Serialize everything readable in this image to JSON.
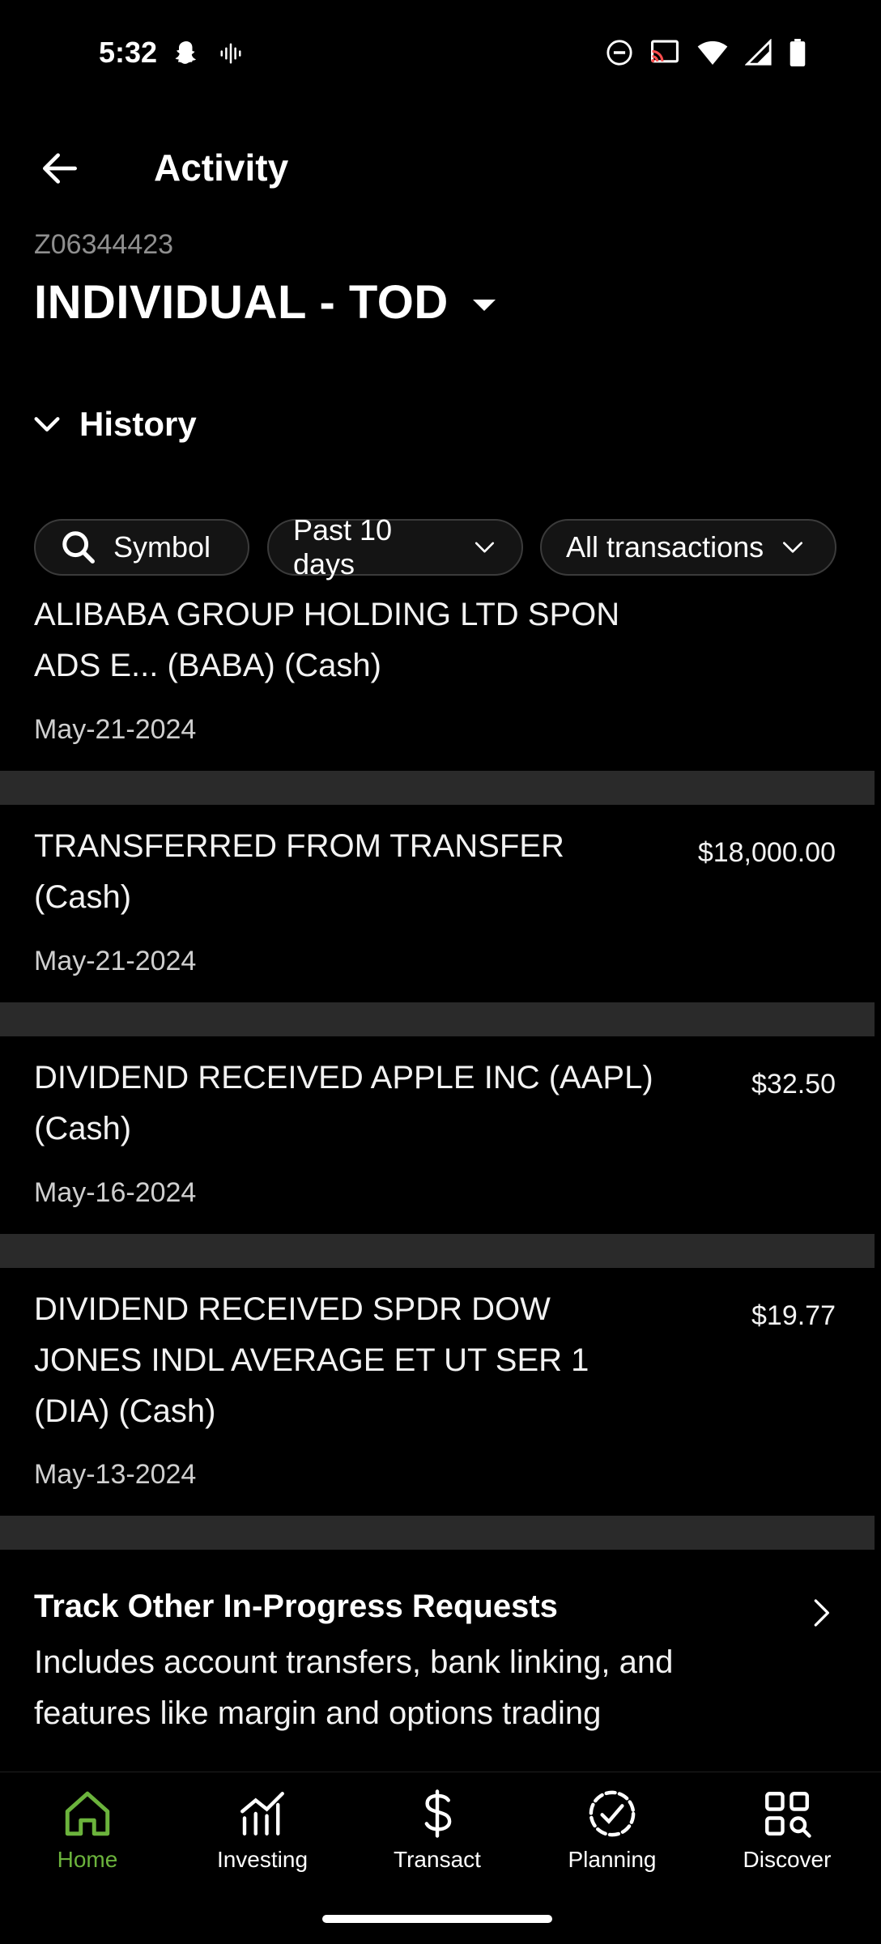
{
  "status_bar": {
    "time": "5:32",
    "icons_left": [
      "snapchat-icon",
      "voice-icon"
    ],
    "icons_right": [
      "dnd-icon",
      "cast-icon",
      "wifi-icon",
      "signal-icon",
      "battery-icon"
    ]
  },
  "header": {
    "title": "Activity",
    "account_number": "Z06344423",
    "account_name": "INDIVIDUAL - TOD"
  },
  "history": {
    "label": "History"
  },
  "filters": {
    "symbol": "Symbol",
    "period": "Past 10 days",
    "type": "All transactions"
  },
  "transactions": [
    {
      "desc_line1": "ALIBABA GROUP HOLDING LTD SPON",
      "desc_line2": "ADS E... (BABA) (Cash)",
      "amount": "",
      "date": "May-21-2024"
    },
    {
      "desc_line1": "TRANSFERRED FROM TRANSFER",
      "desc_line2": "(Cash)",
      "amount": "$18,000.00",
      "date": "May-21-2024"
    },
    {
      "desc_line1": "DIVIDEND RECEIVED APPLE INC (AAPL)",
      "desc_line2": "(Cash)",
      "amount": "$32.50",
      "date": "May-16-2024"
    },
    {
      "desc_line1": "DIVIDEND RECEIVED SPDR DOW",
      "desc_line2": "JONES INDL AVERAGE ET UT SER 1",
      "desc_line3": "(DIA) (Cash)",
      "amount": "$19.77",
      "date": "May-13-2024"
    }
  ],
  "track": {
    "title": "Track Other In-Progress Requests",
    "body_line1": "Includes account transfers, bank linking, and",
    "body_line2": "features like margin and options trading"
  },
  "nav": {
    "items": [
      {
        "label": "Home",
        "icon": "home-icon"
      },
      {
        "label": "Investing",
        "icon": "chart-icon"
      },
      {
        "label": "Transact",
        "icon": "dollar-icon"
      },
      {
        "label": "Planning",
        "icon": "check-circle-icon"
      },
      {
        "label": "Discover",
        "icon": "grid-search-icon"
      }
    ],
    "active_color": "#6bb33c"
  }
}
